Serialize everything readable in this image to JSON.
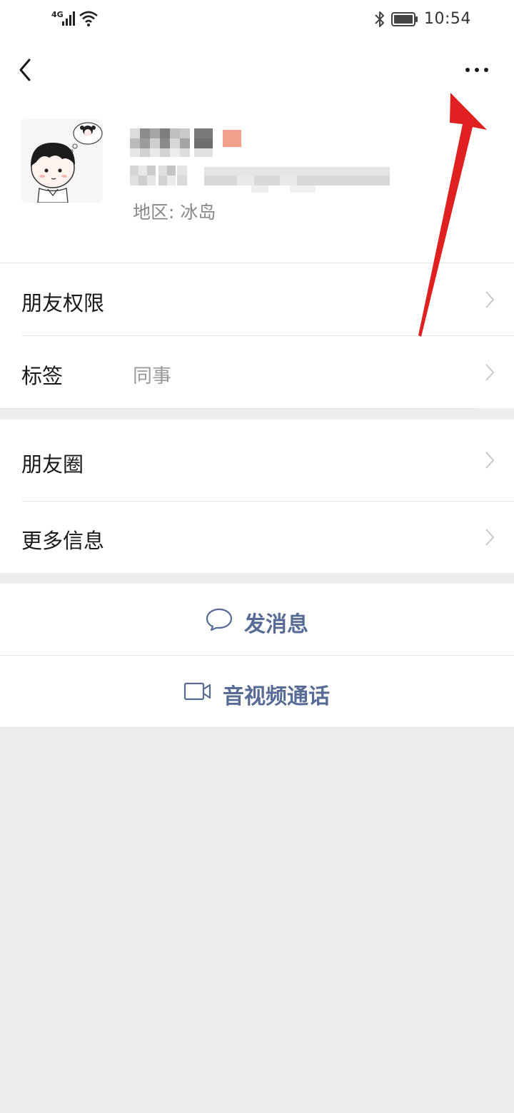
{
  "status_bar": {
    "network": "4G",
    "time": "10:54"
  },
  "profile": {
    "region": "地区: 冰岛"
  },
  "section_1": {
    "friend_permissions": "朋友权限",
    "tags_label": "标签",
    "tags_value": "同事"
  },
  "section_2": {
    "moments": "朋友圈",
    "more_info": "更多信息"
  },
  "actions": {
    "send_message": "发消息",
    "video_call": "音视频通话"
  },
  "colors": {
    "link_blue": "#576b95",
    "annotation_red": "#e02020",
    "background_gray": "#ededed"
  },
  "icons": [
    "back-arrow-icon",
    "more-dots-icon",
    "chat-bubble-icon",
    "video-camera-icon",
    "chevron-right-icon",
    "bluetooth-icon",
    "battery-icon",
    "wifi-icon",
    "signal-icon"
  ]
}
